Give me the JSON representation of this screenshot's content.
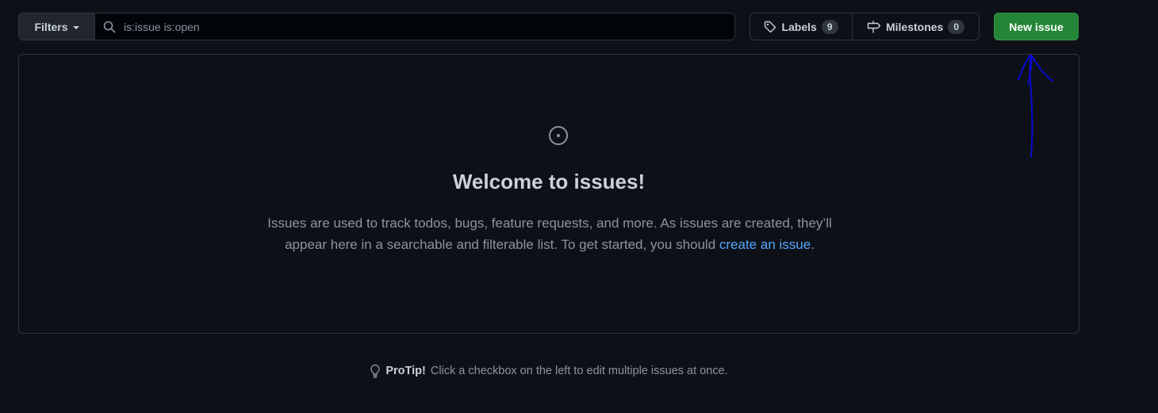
{
  "toolbar": {
    "filters_label": "Filters",
    "search_value": "is:issue is:open",
    "labels_label": "Labels",
    "labels_count": "9",
    "milestones_label": "Milestones",
    "milestones_count": "0",
    "new_issue_label": "New issue"
  },
  "blankslate": {
    "title": "Welcome to issues!",
    "description_part1": "Issues are used to track todos, bugs, feature requests, and more. As issues are created, they’ll appear here in a searchable and filterable list. To get started, you should ",
    "link_text": "create an issue",
    "description_end": "."
  },
  "protip": {
    "strong": "ProTip!",
    "text": "Click a checkbox on the left to edit multiple issues at once."
  },
  "colors": {
    "background": "#0d1117",
    "border": "#30363d",
    "primary_button": "#238636",
    "link": "#58a6ff",
    "annotation": "#0000cc"
  },
  "icons": {
    "search": "search-icon",
    "tag": "tag-icon",
    "milestone": "milestone-icon",
    "issue": "issue-opened-icon",
    "bulb": "light-bulb-icon"
  }
}
